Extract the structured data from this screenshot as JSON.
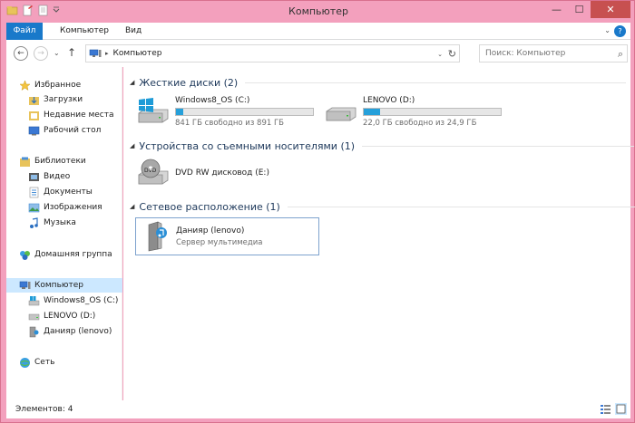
{
  "window": {
    "title": "Компьютер",
    "controls": {
      "minimize": "—",
      "maximize": "☐",
      "close": "✕"
    }
  },
  "ribbon": {
    "tabs": [
      "Файл",
      "Компьютер",
      "Вид"
    ],
    "help": "?",
    "expand": "⌄"
  },
  "address": {
    "back": "←",
    "forward": "→",
    "recent": "⌄",
    "up": "↑",
    "separator": "▸",
    "path": "Компьютер",
    "dropdown": "⌄",
    "refresh": "↻"
  },
  "search": {
    "placeholder": "Поиск: Компьютер",
    "icon": "⌕"
  },
  "sidebar": {
    "favorites": {
      "title": "Избранное",
      "items": [
        "Загрузки",
        "Недавние места",
        "Рабочий стол"
      ]
    },
    "libraries": {
      "title": "Библиотеки",
      "items": [
        "Видео",
        "Документы",
        "Изображения",
        "Музыка"
      ]
    },
    "homegroup": "Домашняя группа",
    "computer": {
      "title": "Компьютер",
      "items": [
        "Windows8_OS (C:)",
        "LENOVO (D:)",
        "Данияр (lenovo)"
      ]
    },
    "network": "Сеть"
  },
  "groups": {
    "hdd": {
      "title": "Жесткие диски (2)",
      "drives": [
        {
          "name": "Windows8_OS (C:)",
          "free": "841 ГБ свободно из 891 ГБ",
          "used_fraction": 0.056
        },
        {
          "name": "LENOVO (D:)",
          "free": "22,0 ГБ свободно из 24,9 ГБ",
          "used_fraction": 0.116
        }
      ]
    },
    "removable": {
      "title": "Устройства со съемными носителями (1)",
      "item": "DVD RW дисковод (E:)"
    },
    "network": {
      "title": "Сетевое расположение (1)",
      "item": {
        "name": "Данияр (lenovo)",
        "desc": "Сервер мультимедиа"
      }
    }
  },
  "status": {
    "count": "Элементов: 4"
  },
  "colors": {
    "accent": "#1979ca",
    "border": "#f3a0bd",
    "bar": "#26a0da",
    "heading": "#1e395b"
  }
}
